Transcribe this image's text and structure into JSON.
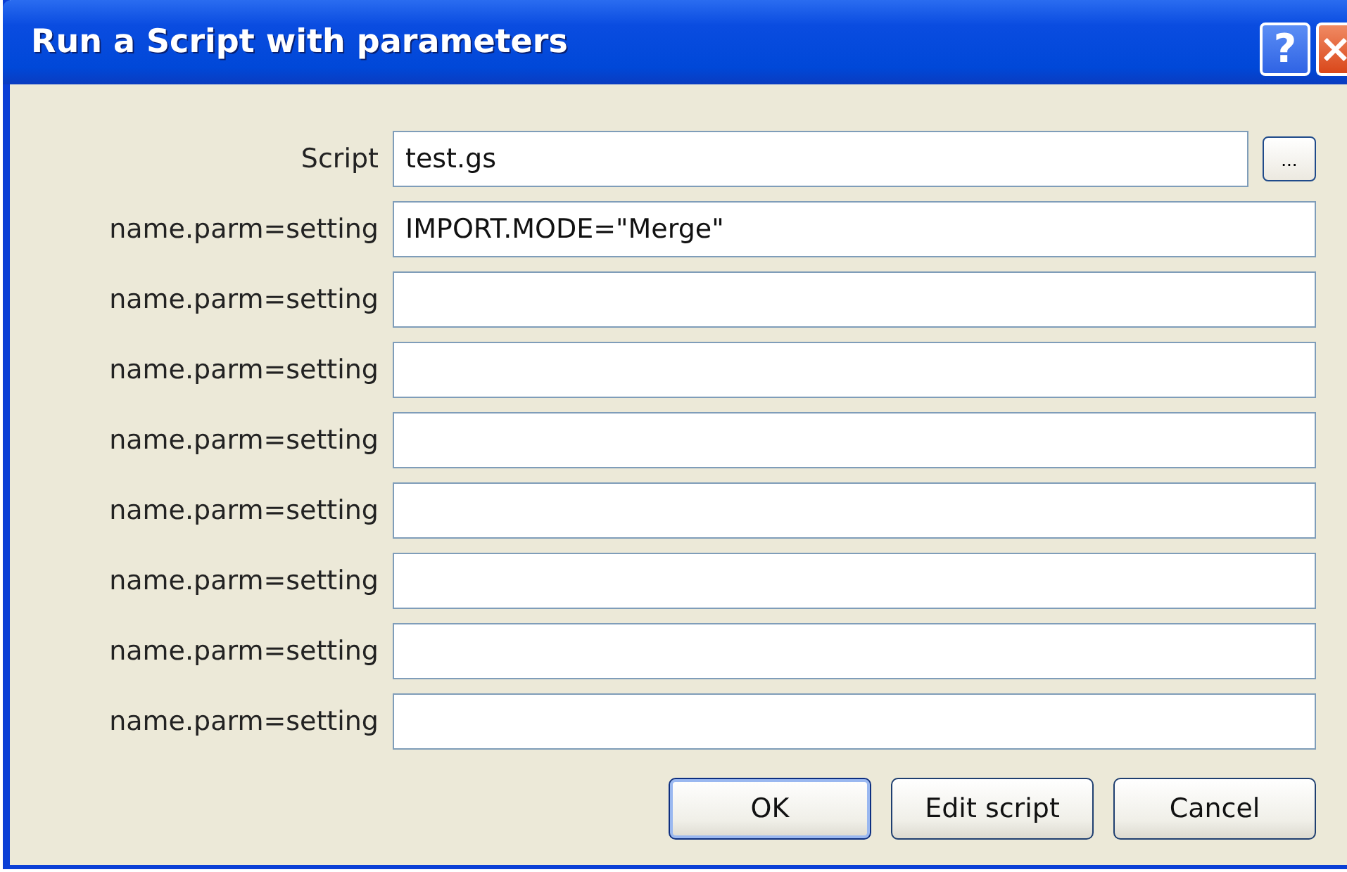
{
  "window": {
    "title": "Run a Script with parameters",
    "help_button": "?",
    "close_button": "×"
  },
  "script": {
    "label": "Script",
    "value": "test.gs",
    "browse_button": "..."
  },
  "parameters": [
    {
      "label": "name.parm=setting",
      "value": "IMPORT.MODE=\"Merge\""
    },
    {
      "label": "name.parm=setting"
    },
    {
      "label": "name.parm=setting"
    },
    {
      "label": "name.parm=setting"
    },
    {
      "label": "name.parm=setting"
    },
    {
      "label": "name.parm=setting"
    },
    {
      "label": "name.parm=setting"
    },
    {
      "label": "name.parm=setting"
    }
  ],
  "buttons": [
    {
      "label": "OK",
      "default": true
    },
    {
      "label": "Edit script",
      "default": false
    },
    {
      "label": "Cancel",
      "default": false
    }
  ]
}
